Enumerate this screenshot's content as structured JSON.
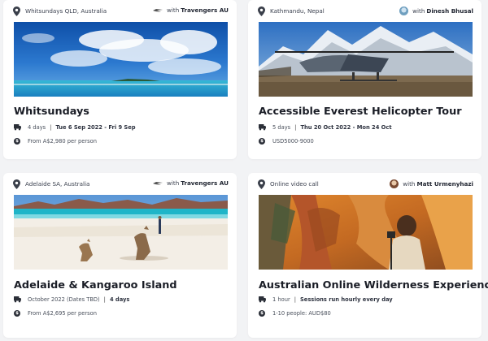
{
  "cards": [
    {
      "location": "Whitsundays QLD, Australia",
      "host_prefix": "with",
      "host_name": "Travengers AU",
      "title": "Whitsundays",
      "duration": "4 days",
      "dates": "Tue 6 Sep 2022 - Fri 9 Sep",
      "price": "From A$2,980 per person"
    },
    {
      "location": "Kathmandu, Nepal",
      "host_prefix": "with",
      "host_name": "Dinesh Bhusal",
      "title": "Accessible Everest Helicopter Tour",
      "duration": "5 days",
      "dates": "Thu 20 Oct 2022 - Mon 24 Oct",
      "price": "USD5000-9000"
    },
    {
      "location": "Adelaide SA, Australia",
      "host_prefix": "with",
      "host_name": "Travengers AU",
      "title": "Adelaide & Kangaroo Island",
      "duration": "October 2022 (Dates TBD)",
      "dates": "4 days",
      "price": "From A$2,695 per person"
    },
    {
      "location": "Online video call",
      "host_prefix": "with",
      "host_name": "Matt Urmenyhazi",
      "title": "Australian Online Wilderness Experience",
      "duration": "1 hour",
      "dates": "Sessions run hourly every day",
      "price": "1-10 people: AUD$80"
    }
  ],
  "icons": {
    "location": "map-pin-icon",
    "duration": "van-icon",
    "price": "dollar-icon"
  },
  "colors": {
    "background": "#f2f3f5",
    "card": "#ffffff",
    "text": "#1f2430"
  }
}
